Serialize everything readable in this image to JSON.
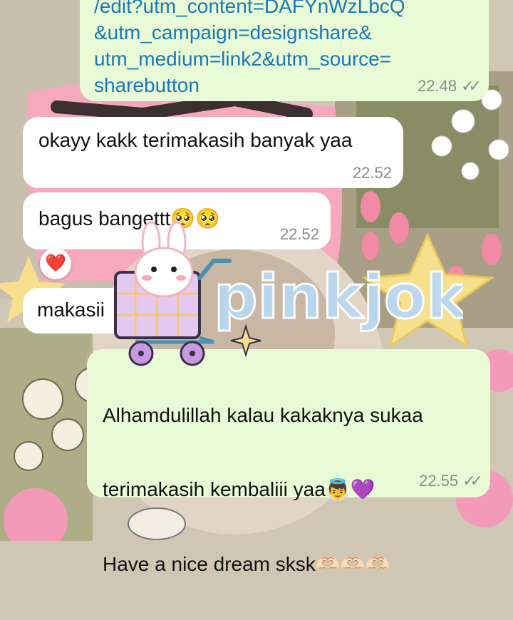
{
  "wallpaper": {
    "background": "#cfc6b4",
    "accent_pink": "#f5a7be",
    "accent_green": "#7a9a58",
    "accent_yellow": "#f6e08e"
  },
  "messages": [
    {
      "id": "m1",
      "direction": "out",
      "lines": [
        "/edit?utm_content=DAFYnWzLbcQ",
        "&utm_campaign=designshare&",
        "utm_medium=link2&utm_source=",
        "sharebutton"
      ],
      "time": "22.48",
      "status": "read"
    },
    {
      "id": "m2",
      "direction": "in",
      "text": "okayy kakk terimakasih banyak yaa",
      "time": "22.52"
    },
    {
      "id": "m3",
      "direction": "in",
      "text": "bagus bangettt🥺🥺",
      "time": "22.52",
      "reaction": "❤️"
    },
    {
      "id": "m4",
      "direction": "in",
      "text": "makasii",
      "time": ""
    },
    {
      "id": "m5",
      "direction": "out",
      "lines": [
        "Alhamdulillah kalau kakaknya sukaa",
        "terimakasih kembaliii yaa👼💜",
        "Have a nice dream sksk🫶🏻🫶🏻🫶🏻"
      ],
      "time": "22.55",
      "status": "read"
    }
  ],
  "sticker": {
    "brand": "pinkjoki",
    "colors": {
      "text": "#b9d8f2",
      "cart": "#e8a9d8",
      "bunny": "#ffffff",
      "grid": "#f3c77a"
    }
  },
  "icons": {
    "read_receipt": "double-check-icon",
    "reaction": "heart-icon"
  }
}
